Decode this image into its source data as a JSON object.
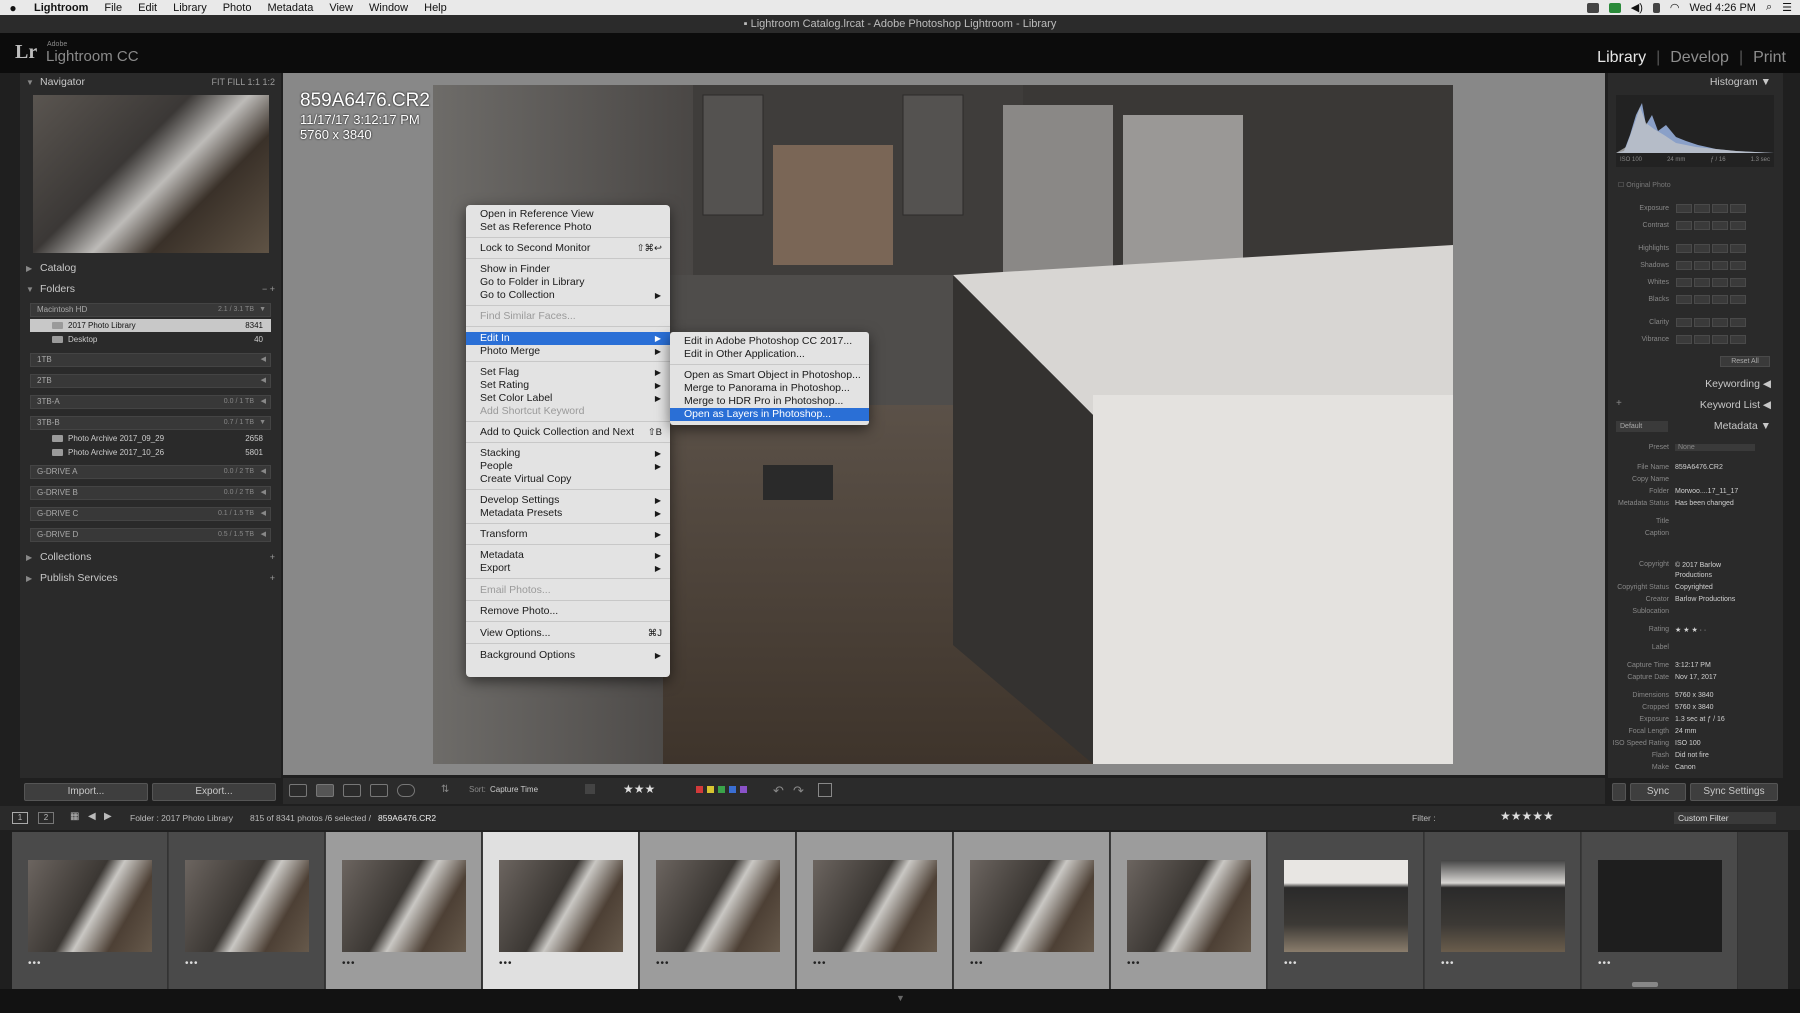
{
  "menubar": {
    "app": "Lightroom",
    "items": [
      "File",
      "Edit",
      "Library",
      "Photo",
      "Metadata",
      "View",
      "Window",
      "Help"
    ],
    "clock": "Wed 4:26 PM"
  },
  "window_title": "Lightroom Catalog.lrcat - Adobe Photoshop Lightroom - Library",
  "identity": {
    "logo": "Lr",
    "adobe": "Adobe",
    "product": "Lightroom CC"
  },
  "modules": {
    "library": "Library",
    "develop": "Develop",
    "print": "Print",
    "sep": "|"
  },
  "left_panel": {
    "navigator": "Navigator",
    "nav_zoom": "FIT  FILL  1:1  1:2",
    "catalog": "Catalog",
    "folders": "Folders",
    "folders_controls": "−  +",
    "volumes": [
      {
        "name": "Macintosh HD",
        "size": "2.1 / 3.1 TB"
      },
      {
        "name": "1TB",
        "size": ""
      },
      {
        "name": "2TB",
        "size": ""
      },
      {
        "name": "3TB-A",
        "size": "0.0 / 1 TB"
      },
      {
        "name": "3TB-B",
        "size": "0.7 / 1 TB"
      },
      {
        "name": "G-DRIVE A",
        "size": "0.0 / 2 TB"
      },
      {
        "name": "G-DRIVE B",
        "size": "0.0 / 2 TB"
      },
      {
        "name": "G-DRIVE C",
        "size": "0.1 / 1.5 TB"
      },
      {
        "name": "G-DRIVE D",
        "size": "0.5 / 1.5 TB"
      }
    ],
    "folders_list": [
      {
        "name": "2017 Photo Library",
        "count": "8341"
      },
      {
        "name": "Desktop",
        "count": "40"
      },
      {
        "name": "Photo Archive 2017_09_29",
        "count": "2658"
      },
      {
        "name": "Photo Archive 2017_10_26",
        "count": "5801"
      }
    ],
    "collections": "Collections",
    "publish": "Publish Services",
    "plus": "+",
    "import": "Import...",
    "export": "Export..."
  },
  "photo_info": {
    "filename": "859A6476.CR2",
    "datetime": "11/17/17 3:12:17 PM",
    "dimensions": "5760 x 3840"
  },
  "context_menu": {
    "items": [
      {
        "label": "Open in Reference View",
        "shortcut": "",
        "arrow": "",
        "disabled": false
      },
      {
        "label": "Set as Reference Photo",
        "shortcut": "",
        "arrow": "",
        "disabled": false
      },
      {
        "label": "Lock to Second Monitor",
        "shortcut": "⇧⌘↩",
        "arrow": "",
        "disabled": false
      },
      {
        "label": "Show in Finder",
        "shortcut": "",
        "arrow": "",
        "disabled": false
      },
      {
        "label": "Go to Folder in Library",
        "shortcut": "",
        "arrow": "",
        "disabled": false
      },
      {
        "label": "Go to Collection",
        "shortcut": "",
        "arrow": "▶",
        "disabled": false
      },
      {
        "label": "Find Similar Faces...",
        "shortcut": "",
        "arrow": "",
        "disabled": true
      },
      {
        "label": "Edit In",
        "shortcut": "",
        "arrow": "▶",
        "disabled": false
      },
      {
        "label": "Photo Merge",
        "shortcut": "",
        "arrow": "▶",
        "disabled": false
      },
      {
        "label": "Set Flag",
        "shortcut": "",
        "arrow": "▶",
        "disabled": false
      },
      {
        "label": "Set Rating",
        "shortcut": "",
        "arrow": "▶",
        "disabled": false
      },
      {
        "label": "Set Color Label",
        "shortcut": "",
        "arrow": "▶",
        "disabled": false
      },
      {
        "label": "Add Shortcut Keyword",
        "shortcut": "",
        "arrow": "",
        "disabled": true
      },
      {
        "label": "Add to Quick Collection and Next",
        "shortcut": "⇧B",
        "arrow": "",
        "disabled": false
      },
      {
        "label": "Stacking",
        "shortcut": "",
        "arrow": "▶",
        "disabled": false
      },
      {
        "label": "People",
        "shortcut": "",
        "arrow": "▶",
        "disabled": false
      },
      {
        "label": "Create Virtual Copy",
        "shortcut": "",
        "arrow": "",
        "disabled": false
      },
      {
        "label": "Develop Settings",
        "shortcut": "",
        "arrow": "▶",
        "disabled": false
      },
      {
        "label": "Metadata Presets",
        "shortcut": "",
        "arrow": "▶",
        "disabled": false
      },
      {
        "label": "Transform",
        "shortcut": "",
        "arrow": "▶",
        "disabled": false
      },
      {
        "label": "Metadata",
        "shortcut": "",
        "arrow": "▶",
        "disabled": false
      },
      {
        "label": "Export",
        "shortcut": "",
        "arrow": "▶",
        "disabled": false
      },
      {
        "label": "Email Photos...",
        "shortcut": "",
        "arrow": "",
        "disabled": true
      },
      {
        "label": "Remove Photo...",
        "shortcut": "",
        "arrow": "",
        "disabled": false
      },
      {
        "label": "View Options...",
        "shortcut": "⌘J",
        "arrow": "",
        "disabled": false
      },
      {
        "label": "Background Options",
        "shortcut": "",
        "arrow": "▶",
        "disabled": false
      }
    ],
    "submenu": [
      "Edit in Adobe Photoshop CC 2017...",
      "Edit in Other Application...",
      "Open as Smart Object in Photoshop...",
      "Merge to Panorama in Photoshop...",
      "Merge to HDR Pro in Photoshop...",
      "Open as Layers in Photoshop..."
    ]
  },
  "toolbar": {
    "sort_label": "Sort:",
    "sort_value": "Capture Time",
    "stars": "★★★"
  },
  "right_panel": {
    "histogram": "Histogram",
    "hist_info": [
      "ISO 100",
      "24 mm",
      "ƒ / 16",
      "1.3 sec"
    ],
    "original_photo": "Original Photo",
    "quick_develop": [
      "Exposure",
      "Contrast",
      "Highlights",
      "Shadows",
      "Whites",
      "Blacks",
      "Clarity",
      "Vibrance"
    ],
    "reset_all": "Reset All",
    "keywording": "Keywording",
    "keyword_list": "Keyword List",
    "metadata": "Metadata",
    "default": "Default",
    "preset_label": "Preset",
    "preset_value": "None",
    "fields": [
      {
        "label": "File Name",
        "value": "859A6476.CR2"
      },
      {
        "label": "Copy Name",
        "value": ""
      },
      {
        "label": "Folder",
        "value": "Morwoo....17_11_17"
      },
      {
        "label": "Metadata Status",
        "value": "Has been changed"
      },
      {
        "label": "Title",
        "value": ""
      },
      {
        "label": "Caption",
        "value": ""
      },
      {
        "label": "Copyright",
        "value": "© 2017 Barlow Productions"
      },
      {
        "label": "Copyright Status",
        "value": "Copyrighted"
      },
      {
        "label": "Creator",
        "value": "Barlow Productions"
      },
      {
        "label": "Sublocation",
        "value": ""
      },
      {
        "label": "Rating",
        "value": "★ ★ ★ · ·"
      },
      {
        "label": "Label",
        "value": ""
      },
      {
        "label": "Capture Time",
        "value": "3:12:17 PM"
      },
      {
        "label": "Capture Date",
        "value": "Nov 17, 2017"
      },
      {
        "label": "Dimensions",
        "value": "5760 x 3840"
      },
      {
        "label": "Cropped",
        "value": "5760 x 3840"
      },
      {
        "label": "Exposure",
        "value": "1.3 sec at ƒ / 16"
      },
      {
        "label": "Focal Length",
        "value": "24 mm"
      },
      {
        "label": "ISO Speed Rating",
        "value": "ISO 100"
      },
      {
        "label": "Flash",
        "value": "Did not fire"
      },
      {
        "label": "Make",
        "value": "Canon"
      }
    ],
    "sync": "Sync",
    "sync_settings": "Sync Settings"
  },
  "filmstrip_bar": {
    "page1": "1",
    "page2": "2",
    "source": "Folder : 2017 Photo Library",
    "count": "815 of 8341 photos /6 selected /",
    "current": "859A6476.CR2",
    "filter_label": "Filter :",
    "filter_value": "Custom Filter"
  },
  "filmstrip": {
    "dots": "•••"
  },
  "colors": {
    "menu_highlight": "#2a6fd6",
    "panel_bg": "#2a2a2a",
    "center_bg": "#888888"
  }
}
